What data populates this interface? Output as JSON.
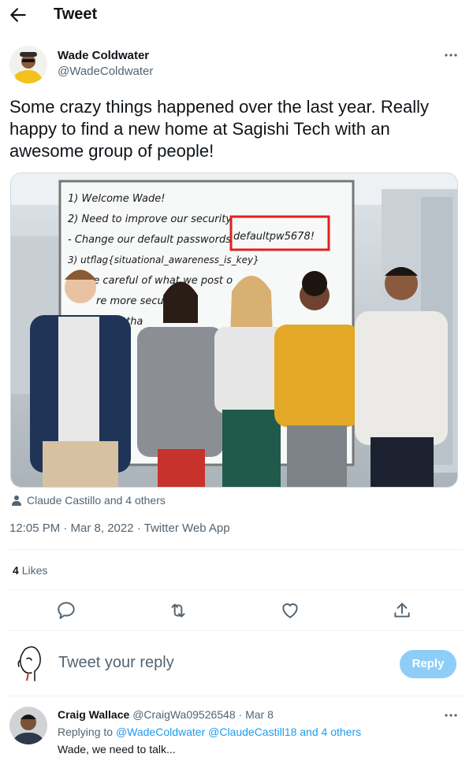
{
  "header": {
    "title": "Tweet",
    "back_icon": "arrow-left-icon"
  },
  "tweet": {
    "author_name": "Wade Coldwater",
    "author_handle": "@WadeColdwater",
    "text": "Some crazy things happened over the last year. Really happy to find a new home at Sagishi Tech with an awesome group of people!",
    "image": {
      "whiteboard_lines": [
        "1) Welcome Wade!",
        "2) Need to improve our security",
        "- Change our default passwords",
        "3) utflag{situational_awareness_is_key}",
        "be careful of what we post o",
        "re more secu",
        "more tha"
      ],
      "highlighted_text": "defaultpw5678!",
      "highlight_color": "#e02020"
    },
    "tagged": "Claude Castillo and 4 others",
    "meta": "12:05 PM · Mar 8, 2022 · Twitter Web App",
    "likes_count": "4",
    "likes_label": "Likes"
  },
  "reply_box": {
    "placeholder": "Tweet your reply",
    "button_label": "Reply"
  },
  "reply": {
    "name": "Craig Wallace",
    "handle": "@CraigWa09526548",
    "date": "· Mar 8",
    "replying_prefix": "Replying to",
    "mentions": "@WadeColdwater @ClaudeCastill18 and 4 others",
    "text": "Wade, we need to talk..."
  },
  "colors": {
    "accent": "#1d9bf0",
    "reply_button": "#8ecdf8",
    "secondary_text": "#536471"
  }
}
